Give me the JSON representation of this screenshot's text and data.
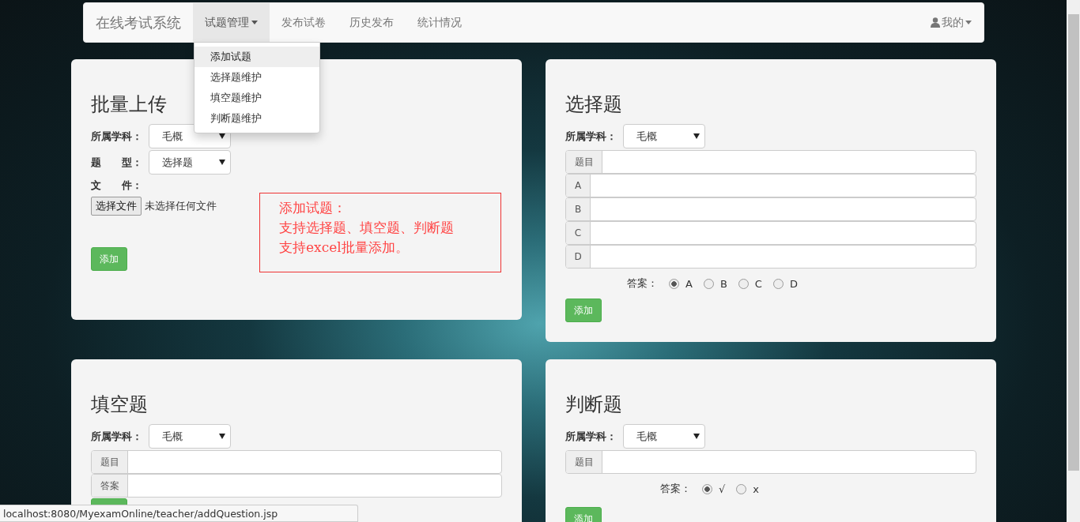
{
  "navbar": {
    "brand": "在线考试系统",
    "items": [
      {
        "label": "试题管理",
        "selected": true,
        "has_menu": true
      },
      {
        "label": "发布试卷",
        "selected": false,
        "has_menu": false
      },
      {
        "label": "历史发布",
        "selected": false,
        "has_menu": false
      },
      {
        "label": "统计情况",
        "selected": false,
        "has_menu": false
      }
    ],
    "user": "我的"
  },
  "dropdown_menu": {
    "items": [
      {
        "label": "添加试题",
        "selected": true
      },
      {
        "label": "选择题维护",
        "selected": false
      },
      {
        "label": "填空题维护",
        "selected": false
      },
      {
        "label": "判断题维护",
        "selected": false
      }
    ]
  },
  "panels": [
    {
      "kind": "batch",
      "title": "批量上传",
      "subject_label": "所属学科：",
      "subject_value": "毛概",
      "type_label": "题　　型：",
      "type_value": "选择题",
      "file_label": "文　　件：",
      "file_button": "选择文件",
      "file_status": "未选择任何文件",
      "submit": "添加",
      "annotation": [
        "添加试题：",
        "支持选择题、填空题、判断题",
        "支持excel批量添加。"
      ]
    },
    {
      "kind": "choice",
      "title": "选择题",
      "subject_label": "所属学科：",
      "subject_value": "毛概",
      "inputs": [
        {
          "label": "题目"
        },
        {
          "label": "A"
        },
        {
          "label": "B"
        },
        {
          "label": "C"
        },
        {
          "label": "D"
        }
      ],
      "answer_label": "答案：",
      "options": [
        {
          "label": "A",
          "selected": true
        },
        {
          "label": "B",
          "selected": false
        },
        {
          "label": "C",
          "selected": false
        },
        {
          "label": "D",
          "selected": false
        }
      ],
      "submit": "添加"
    },
    {
      "kind": "blank",
      "title": "填空题",
      "subject_label": "所属学科：",
      "subject_value": "毛概",
      "inputs": [
        {
          "label": "题目"
        },
        {
          "label": "答案"
        }
      ]
    },
    {
      "kind": "judge",
      "title": "判断题",
      "subject_label": "所属学科：",
      "subject_value": "毛概",
      "inputs": [
        {
          "label": "题目"
        }
      ],
      "answer_label": "答案：",
      "options": [
        {
          "label": "√",
          "selected": true
        },
        {
          "label": "x",
          "selected": false
        }
      ],
      "submit": "添加"
    }
  ],
  "status_bar": {
    "url": "localhost:8080/MyexamOnline/teacher/addQuestion.jsp"
  }
}
